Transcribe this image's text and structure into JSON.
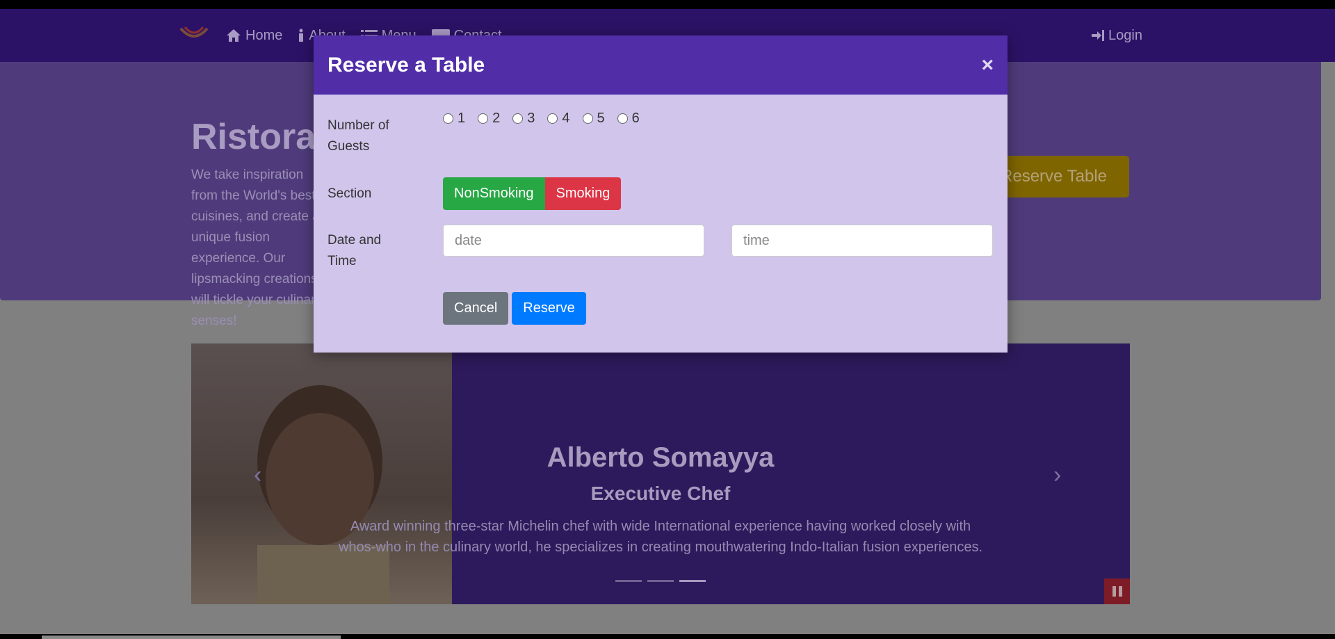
{
  "nav": {
    "items": [
      {
        "label": "Home",
        "icon": "home-icon"
      },
      {
        "label": "About",
        "icon": "info-icon"
      },
      {
        "label": "Menu",
        "icon": "list-icon"
      },
      {
        "label": "Contact",
        "icon": "address-card-icon"
      }
    ],
    "login_label": "Login"
  },
  "jumbotron": {
    "title": "Ristorante Con Fusion",
    "text": "We take inspiration from the World's best cuisines, and create a unique fusion experience. Our lipsmacking creations will tickle your culinary senses!",
    "reserve_label": "Reserve Table"
  },
  "carousel": {
    "name": "Alberto Somayya",
    "role": "Executive Chef",
    "description": "Award winning three-star Michelin chef with wide International experience having worked closely with whos-who in the culinary world, he specializes in creating mouthwatering Indo-Italian fusion experiences.",
    "indicator_active": 2
  },
  "modal": {
    "title": "Reserve a Table",
    "close": "×",
    "guests_label": "Number of Guests",
    "guests_options": [
      "1",
      "2",
      "3",
      "4",
      "5",
      "6"
    ],
    "section_label": "Section",
    "section_options": [
      "NonSmoking",
      "Smoking"
    ],
    "datetime_label": "Date and Time",
    "date_placeholder": "date",
    "time_placeholder": "time",
    "cancel_label": "Cancel",
    "reserve_label": "Reserve"
  },
  "colors": {
    "navbar": "#512da8",
    "modal_header": "#512da8",
    "modal_body": "#d1c4e9",
    "green": "#28a745",
    "red": "#dc3545",
    "blue": "#007bff",
    "gray": "#6c757d"
  }
}
